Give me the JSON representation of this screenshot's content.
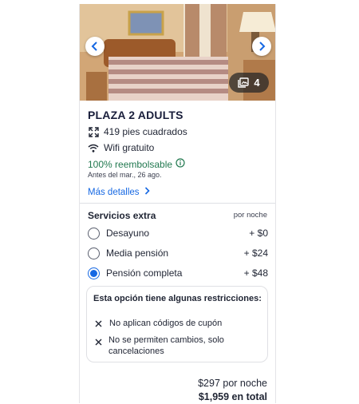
{
  "room": {
    "title": "PLAZA 2 ADULTS",
    "features": [
      {
        "icon": "expand-arrows-icon",
        "label": "419 pies cuadrados"
      },
      {
        "icon": "wifi-icon",
        "label": "Wifi gratuito"
      }
    ],
    "refund_label": "100% reembolsable",
    "refund_date": "Antes del mar., 26 ago.",
    "more_details": "Más detalles",
    "photo_count": "4"
  },
  "extras": {
    "title": "Servicios extra",
    "unit": "por noche",
    "options": [
      {
        "label": "Desayuno",
        "price": "+ $0",
        "selected": false
      },
      {
        "label": "Media pensión",
        "price": "+ $24",
        "selected": false
      },
      {
        "label": "Pensión completa",
        "price": "+ $48",
        "selected": true
      }
    ]
  },
  "restrictions": {
    "title": "Esta opción tiene algunas restricciones:",
    "items": [
      "No aplican códigos de cupón",
      "No se permiten cambios, solo cancelaciones"
    ]
  },
  "pricing": {
    "per_night": "$297 por noche",
    "total": "$1,959 en total"
  },
  "colors": {
    "accent": "#1668e3",
    "refund": "#227950",
    "text": "#191e3b"
  }
}
